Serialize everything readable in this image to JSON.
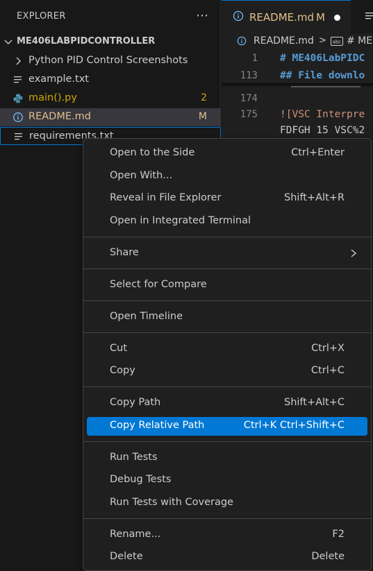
{
  "explorer": {
    "title": "EXPLORER",
    "folder": "ME406LABPIDCONTROLLER",
    "items": [
      {
        "label": "Python PID Control Screenshots",
        "type": "folder"
      },
      {
        "label": "example.txt",
        "type": "text"
      },
      {
        "label": "main().py",
        "type": "python",
        "badge": "2",
        "label_color": "#cca700",
        "badge_color": "#cca700"
      },
      {
        "label": "README.md",
        "type": "info",
        "badge": "M",
        "label_color": "#e2c08d",
        "badge_color": "#e2c08d",
        "selected": true
      },
      {
        "label": "requirements.txt",
        "type": "text",
        "focused": true
      }
    ]
  },
  "editor": {
    "tab": {
      "label": "README.md",
      "modified": "M"
    },
    "breadcrumb": {
      "file": "README.md",
      "separator": ">",
      "symbol": "# ME"
    },
    "lines": [
      {
        "num": "1",
        "text": "# ME406LabPIDC",
        "style": "heading"
      },
      {
        "num": "113",
        "text": "## File downlo",
        "style": "heading"
      },
      {
        "num": "174",
        "text": "",
        "style": "plain"
      },
      {
        "num": "175",
        "text": "![VSC Interpre",
        "style": "link"
      },
      {
        "num": "",
        "text": "FDFGH 15 VSC%2",
        "style": "plain"
      }
    ]
  },
  "context_menu": {
    "groups": [
      [
        {
          "label": "Open to the Side",
          "shortcut": "Ctrl+Enter"
        },
        {
          "label": "Open With...",
          "shortcut": ""
        },
        {
          "label": "Reveal in File Explorer",
          "shortcut": "Shift+Alt+R"
        },
        {
          "label": "Open in Integrated Terminal",
          "shortcut": ""
        }
      ],
      [
        {
          "label": "Share",
          "shortcut": "",
          "submenu": true
        }
      ],
      [
        {
          "label": "Select for Compare",
          "shortcut": ""
        }
      ],
      [
        {
          "label": "Open Timeline",
          "shortcut": ""
        }
      ],
      [
        {
          "label": "Cut",
          "shortcut": "Ctrl+X"
        },
        {
          "label": "Copy",
          "shortcut": "Ctrl+C"
        }
      ],
      [
        {
          "label": "Copy Path",
          "shortcut": "Shift+Alt+C"
        },
        {
          "label": "Copy Relative Path",
          "shortcut": "Ctrl+K Ctrl+Shift+C",
          "highlighted": true
        }
      ],
      [
        {
          "label": "Run Tests",
          "shortcut": ""
        },
        {
          "label": "Debug Tests",
          "shortcut": ""
        },
        {
          "label": "Run Tests with Coverage",
          "shortcut": ""
        }
      ],
      [
        {
          "label": "Rename...",
          "shortcut": "F2"
        },
        {
          "label": "Delete",
          "shortcut": "Delete"
        }
      ]
    ]
  },
  "colors": {
    "accent": "#0078d4",
    "modified": "#e2c08d",
    "warning": "#cca700",
    "info_icon": "#75beff",
    "python_icon": "#519aba"
  }
}
